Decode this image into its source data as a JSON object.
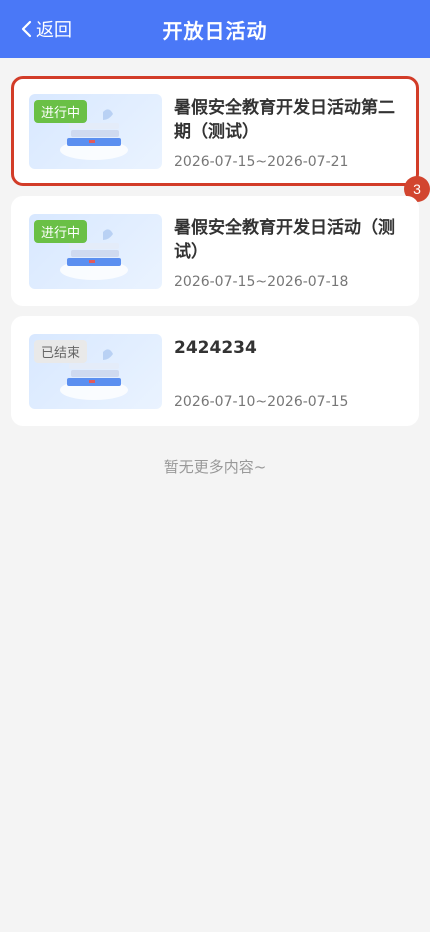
{
  "header": {
    "back_label": "返回",
    "title": "开放日活动"
  },
  "activities": [
    {
      "status": "进行中",
      "title": "暑假安全教育开发日活动第二期（测试）",
      "date_range": "2026-07-15~2026-07-21",
      "highlight_number": "3"
    },
    {
      "status": "进行中",
      "title": "暑假安全教育开发日活动（测试）",
      "date_range": "2026-07-15~2026-07-18"
    },
    {
      "status": "已结束",
      "title": "2424234",
      "date_range": "2026-07-10~2026-07-15"
    }
  ],
  "footer_text": "暂无更多内容~",
  "colors": {
    "header": "#4a78f7",
    "active": "#6ac046",
    "ended": "#e9e9e9",
    "highlight": "#d23c28"
  },
  "icons": [
    "chevron-left-icon",
    "book-stack-icon"
  ]
}
